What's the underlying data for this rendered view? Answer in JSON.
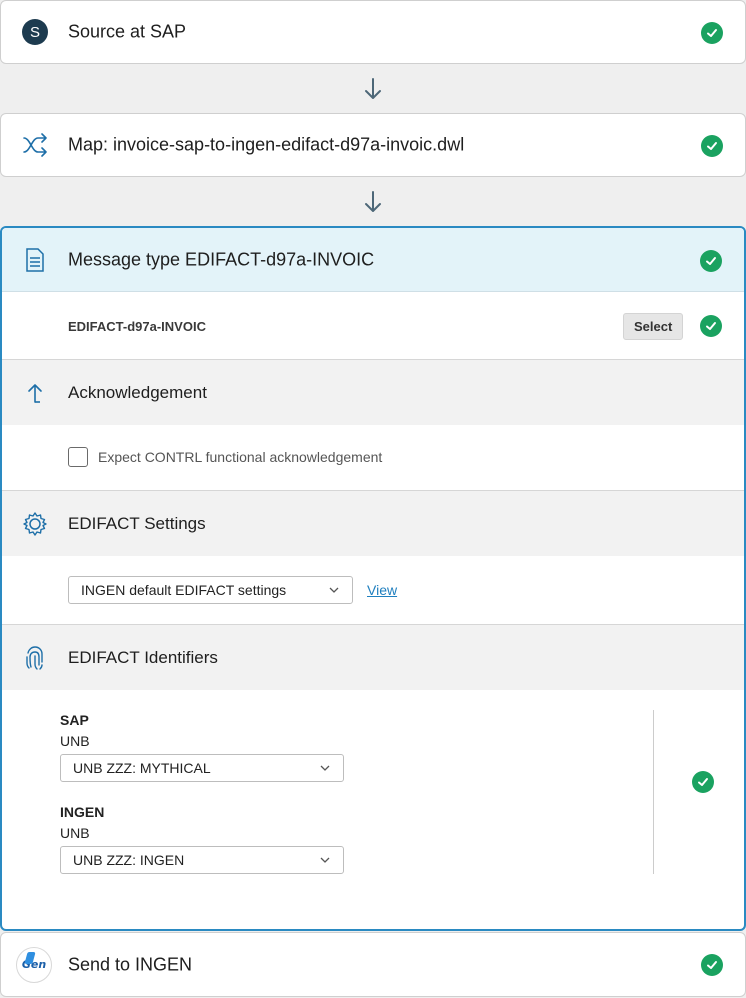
{
  "steps": {
    "source": {
      "avatar_letter": "S",
      "title": "Source at SAP"
    },
    "map": {
      "title": "Map: invoice-sap-to-ingen-edifact-d97a-invoic.dwl"
    },
    "message": {
      "title": "Message type EDIFACT-d97a-INVOIC",
      "type_value": "EDIFACT-d97a-INVOIC",
      "select_label": "Select"
    },
    "send": {
      "title": "Send to INGEN",
      "logo_text": "Gen"
    }
  },
  "acknowledgement": {
    "title": "Acknowledgement",
    "checkbox_label": "Expect CONTRL functional acknowledgement",
    "checked": false
  },
  "edifact_settings": {
    "title": "EDIFACT Settings",
    "selected": "INGEN default EDIFACT settings",
    "view_label": "View"
  },
  "edifact_identifiers": {
    "title": "EDIFACT Identifiers",
    "sap": {
      "party": "SAP",
      "type": "UNB",
      "selected": "UNB ZZZ: MYTHICAL"
    },
    "ingen": {
      "party": "INGEN",
      "type": "UNB",
      "selected": "UNB ZZZ: INGEN"
    }
  },
  "colors": {
    "accent": "#2a8ac2",
    "success": "#1aa260",
    "avatar": "#1d3b4f"
  },
  "icons": {
    "source": "letter-avatar",
    "map": "shuffle-icon",
    "message": "document-icon",
    "ack": "arrow-up-icon",
    "settings": "gear-icon",
    "identifiers": "fingerprint-icon",
    "status": "check-circle-icon"
  }
}
